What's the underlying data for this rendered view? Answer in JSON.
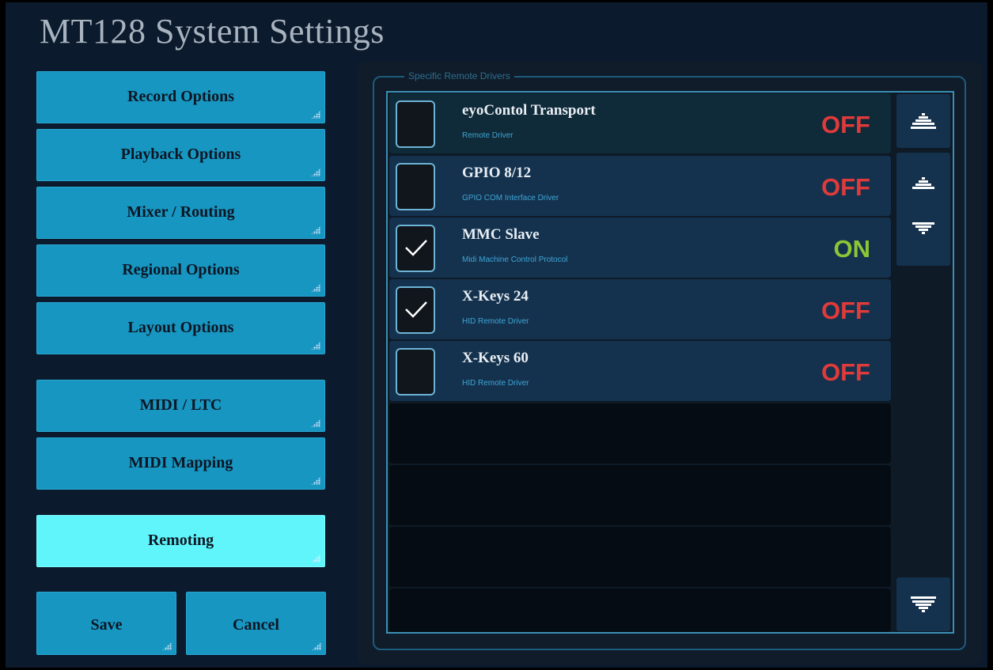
{
  "title": "MT128 System Settings",
  "nav": {
    "record": "Record Options",
    "playback": "Playback Options",
    "mixer": "Mixer / Routing",
    "regional": "Regional Options",
    "layout": "Layout Options",
    "midi_ltc": "MIDI / LTC",
    "midi_mapping": "MIDI Mapping",
    "remoting": "Remoting",
    "save": "Save",
    "cancel": "Cancel"
  },
  "remote_panel": {
    "legend": "Specific Remote Drivers",
    "drivers": [
      {
        "name": "eyoContol Transport",
        "desc": "Remote Driver",
        "checked": false,
        "state": "OFF"
      },
      {
        "name": "GPIO 8/12",
        "desc": "GPIO COM Interface Driver",
        "checked": false,
        "state": "OFF"
      },
      {
        "name": "MMC Slave",
        "desc": "Midi Machine Control Protocol",
        "checked": true,
        "state": "ON"
      },
      {
        "name": "X-Keys 24",
        "desc": "HID Remote Driver",
        "checked": true,
        "state": "OFF"
      },
      {
        "name": "X-Keys 60",
        "desc": "HID Remote Driver",
        "checked": false,
        "state": "OFF"
      }
    ]
  },
  "colors": {
    "off": "#e13a3a",
    "on": "#8cc637",
    "button": "#1796c2",
    "active_button": "#5ff5fb"
  },
  "icons": {
    "scroll_top": "arrow-up-top-icon",
    "scroll_up": "arrow-up-icon",
    "scroll_down": "arrow-down-icon",
    "scroll_bottom": "arrow-down-bottom-icon",
    "check": "checkmark-icon",
    "grip": "resize-grip-icon"
  }
}
